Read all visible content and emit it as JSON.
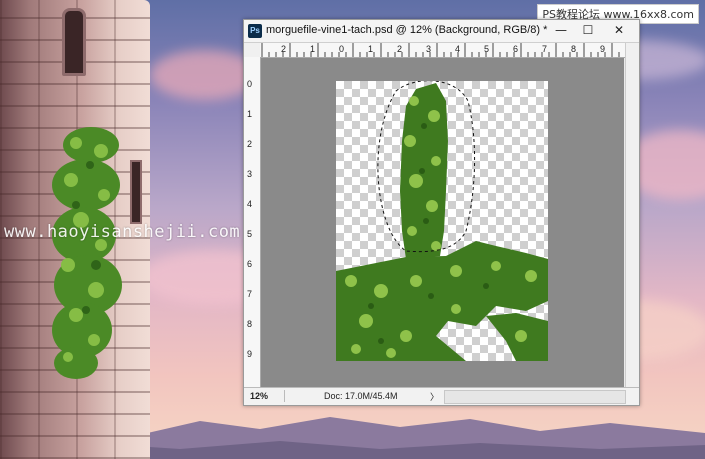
{
  "background": {
    "watermark_text": "www.haoyisanshejii.com",
    "site_logo": "PS教程论坛 www.16xx8.com"
  },
  "window": {
    "title": "morguefile-vine1-tach.psd @ 12% (Background, RGB/8) *",
    "app_icon": "Ps",
    "minimize_glyph": "—",
    "maximize_glyph": "☐",
    "close_glyph": "✕"
  },
  "rulers": {
    "horizontal": [
      "2",
      "1",
      "0",
      "1",
      "2",
      "3",
      "4",
      "5",
      "6",
      "7",
      "8",
      "9"
    ],
    "vertical": [
      "0",
      "1",
      "2",
      "3",
      "4",
      "5",
      "6",
      "7",
      "8",
      "9"
    ]
  },
  "status": {
    "zoom": "12%",
    "doc_info": "Doc: 17.0M/45.4M",
    "arrow_glyph": "〉"
  },
  "colors": {
    "ivy_dark": "#3f7a1f",
    "ivy_light": "#8fc24a",
    "canvas_gray": "#8a8a8a"
  }
}
